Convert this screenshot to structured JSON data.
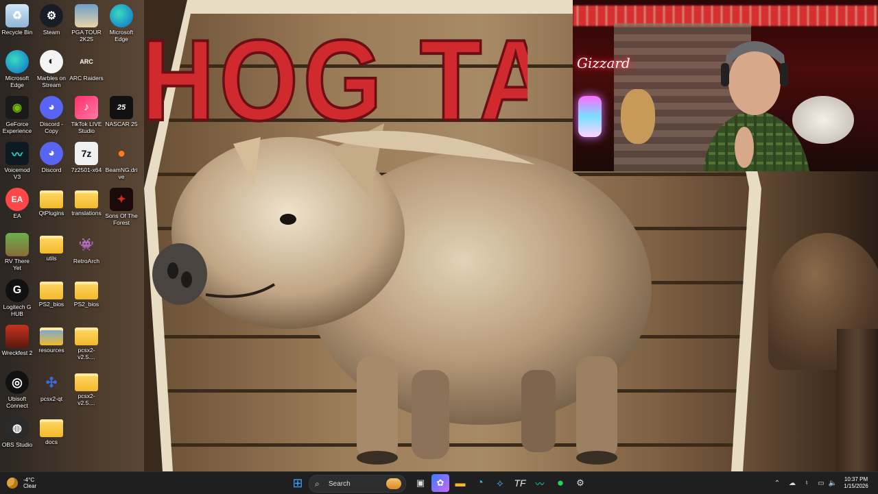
{
  "wallpaper": {
    "sign_title": "HOG TAI"
  },
  "webcam": {
    "neon_sign": "Gizzard"
  },
  "desktop_icons": [
    {
      "label": "Recycle Bin",
      "icon": "recycle-bin-icon"
    },
    {
      "label": "Steam",
      "icon": "steam-icon"
    },
    {
      "label": "PGA TOUR 2K25",
      "icon": "pga-tour-icon"
    },
    {
      "label": "Microsoft Edge",
      "icon": "edge-icon"
    },
    {
      "label": "Microsoft Edge",
      "icon": "edge-icon"
    },
    {
      "label": "Marbles on Stream",
      "icon": "marbles-icon"
    },
    {
      "label": "ARC Raiders",
      "icon": "arc-raiders-icon"
    },
    {
      "label": "GeForce Experience",
      "icon": "geforce-icon"
    },
    {
      "label": "Discord - Copy",
      "icon": "discord-icon"
    },
    {
      "label": "TikTok LIVE Studio",
      "icon": "tiktok-icon"
    },
    {
      "label": "NASCAR 25",
      "icon": "nascar-icon"
    },
    {
      "label": "Voicemod V3",
      "icon": "voicemod-icon"
    },
    {
      "label": "Discord",
      "icon": "discord-icon"
    },
    {
      "label": "7z2501-x64",
      "icon": "7zip-icon"
    },
    {
      "label": "BeamNG.drive",
      "icon": "beamng-icon"
    },
    {
      "label": "EA",
      "icon": "ea-icon"
    },
    {
      "label": "QtPlugins",
      "icon": "folder-icon"
    },
    {
      "label": "translations",
      "icon": "folder-icon"
    },
    {
      "label": "Sons Of The Forest",
      "icon": "sons-forest-icon"
    },
    {
      "label": "RV There Yet",
      "icon": "rv-there-yet-icon"
    },
    {
      "label": "utils",
      "icon": "folder-icon"
    },
    {
      "label": "RetroArch",
      "icon": "retroarch-icon"
    },
    {
      "label": "Logitech G HUB",
      "icon": "logitech-icon"
    },
    {
      "label": "PS2_bios",
      "icon": "folder-icon"
    },
    {
      "label": "PS2_bios",
      "icon": "folder-icon"
    },
    {
      "label": "Wreckfest 2",
      "icon": "wreckfest-icon"
    },
    {
      "label": "resources",
      "icon": "folder-icon"
    },
    {
      "label": "pcsx2-v2.5....",
      "icon": "folder-icon"
    },
    {
      "label": "Ubisoft Connect",
      "icon": "ubisoft-icon"
    },
    {
      "label": "pcsx2-qt",
      "icon": "pcsx2-icon"
    },
    {
      "label": "pcsx2-v2.5....",
      "icon": "folder-icon"
    },
    {
      "label": "OBS Studio",
      "icon": "obs-icon"
    },
    {
      "label": "docs",
      "icon": "folder-icon"
    }
  ],
  "taskbar": {
    "weather": {
      "temp": "-4°C",
      "condition": "Clear"
    },
    "search_placeholder": "Search",
    "clock": {
      "time": "10:37 PM",
      "date": "1/15/2026"
    }
  },
  "colors": {
    "sign_red": "#d02a2e",
    "taskbar_bg": "#1f1f1f",
    "folder_yellow": "#f2b92c"
  }
}
